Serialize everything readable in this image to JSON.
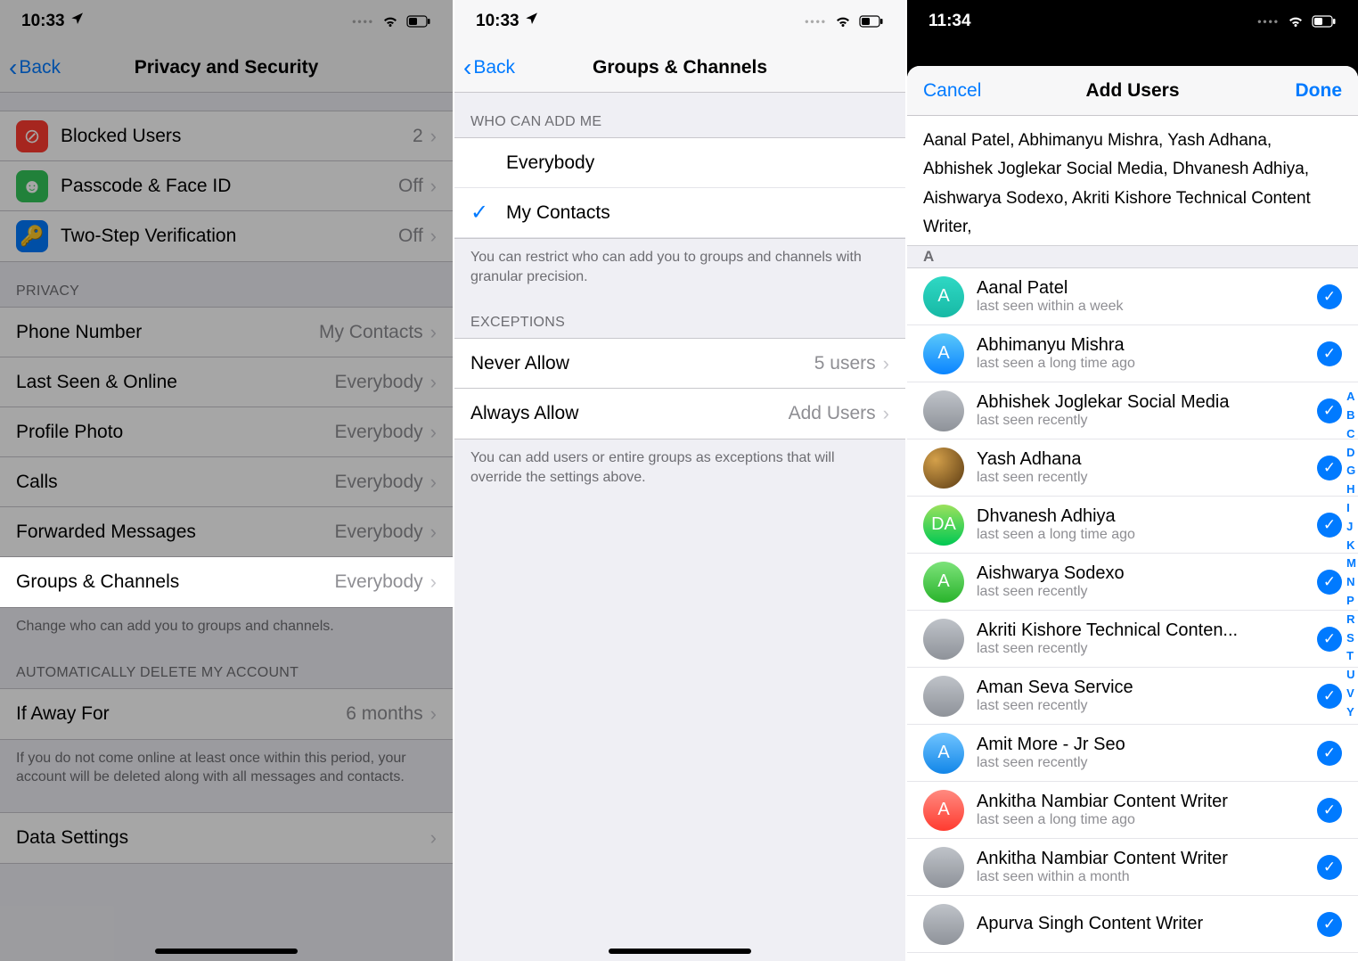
{
  "phone1": {
    "time": "10:33",
    "back": "Back",
    "title": "Privacy and Security",
    "security_rows": [
      {
        "icon": "⊘",
        "cls": "icon-red",
        "label": "Blocked Users",
        "value": "2"
      },
      {
        "icon": "☻",
        "cls": "icon-green",
        "label": "Passcode & Face ID",
        "value": "Off"
      },
      {
        "icon": "🔑",
        "cls": "icon-blue",
        "label": "Two-Step Verification",
        "value": "Off"
      }
    ],
    "privacy_header": "PRIVACY",
    "privacy_rows": [
      {
        "label": "Phone Number",
        "value": "My Contacts"
      },
      {
        "label": "Last Seen & Online",
        "value": "Everybody"
      },
      {
        "label": "Profile Photo",
        "value": "Everybody"
      },
      {
        "label": "Calls",
        "value": "Everybody"
      },
      {
        "label": "Forwarded Messages",
        "value": "Everybody"
      },
      {
        "label": "Groups & Channels",
        "value": "Everybody",
        "highlight": true
      }
    ],
    "privacy_footer": "Change who can add you to groups and channels.",
    "auto_header": "AUTOMATICALLY DELETE MY ACCOUNT",
    "auto_row": {
      "label": "If Away For",
      "value": "6 months"
    },
    "auto_footer": "If you do not come online at least once within this period, your account will be deleted along with all messages and contacts.",
    "data_row_label": "Data Settings"
  },
  "phone2": {
    "time": "10:33",
    "back": "Back",
    "title": "Groups & Channels",
    "who_header": "WHO CAN ADD ME",
    "options": [
      {
        "label": "Everybody",
        "checked": false
      },
      {
        "label": "My Contacts",
        "checked": true
      }
    ],
    "who_footer": "You can restrict who can add you to groups and channels with granular precision.",
    "ex_header": "EXCEPTIONS",
    "ex_rows": [
      {
        "label": "Never Allow",
        "value": "5 users"
      },
      {
        "label": "Always Allow",
        "value": "Add Users"
      }
    ],
    "ex_footer": "You can add users or entire groups as exceptions that will override the settings above."
  },
  "phone3": {
    "time": "11:34",
    "cancel": "Cancel",
    "title": "Add Users",
    "done": "Done",
    "tokens": [
      "Aanal Patel",
      "Abhimanyu Mishra",
      "Yash Adhana",
      "Abhishek Joglekar Social Media",
      "Dhvanesh Adhiya",
      "Aishwarya Sodexo",
      "Akriti Kishore Technical Content Writer"
    ],
    "index_letter": "A",
    "contacts": [
      {
        "initial": "A",
        "cls": "av-teal",
        "name": "Aanal Patel",
        "status": "last seen within a week"
      },
      {
        "initial": "A",
        "cls": "av-blue",
        "name": "Abhimanyu Mishra",
        "status": "last seen a long time ago"
      },
      {
        "initial": "",
        "cls": "av-gray",
        "name": "Abhishek Joglekar Social Media",
        "status": "last seen recently"
      },
      {
        "initial": "",
        "cls": "av-pic",
        "name": "Yash Adhana",
        "status": "last seen recently"
      },
      {
        "initial": "DA",
        "cls": "av-green",
        "name": "Dhvanesh Adhiya",
        "status": "last seen a long time ago"
      },
      {
        "initial": "A",
        "cls": "av-green2",
        "name": "Aishwarya Sodexo",
        "status": "last seen recently"
      },
      {
        "initial": "",
        "cls": "av-gray",
        "name": "Akriti Kishore Technical Conten...",
        "status": "last seen recently"
      },
      {
        "initial": "",
        "cls": "av-gray",
        "name": "Aman Seva Service",
        "status": "last seen recently"
      },
      {
        "initial": "A",
        "cls": "av-blue2",
        "name": "Amit More - Jr Seo",
        "status": "last seen recently"
      },
      {
        "initial": "A",
        "cls": "av-red",
        "name": "Ankitha Nambiar Content Writer",
        "status": "last seen a long time ago"
      },
      {
        "initial": "",
        "cls": "av-gray",
        "name": "Ankitha Nambiar Content Writer",
        "status": "last seen within a month"
      },
      {
        "initial": "",
        "cls": "av-gray",
        "name": "Apurva Singh Content Writer",
        "status": ""
      }
    ],
    "index_bar": [
      "A",
      "B",
      "C",
      "D",
      "G",
      "H",
      "I",
      "J",
      "K",
      "M",
      "N",
      "P",
      "R",
      "S",
      "T",
      "U",
      "V",
      "Y"
    ]
  }
}
